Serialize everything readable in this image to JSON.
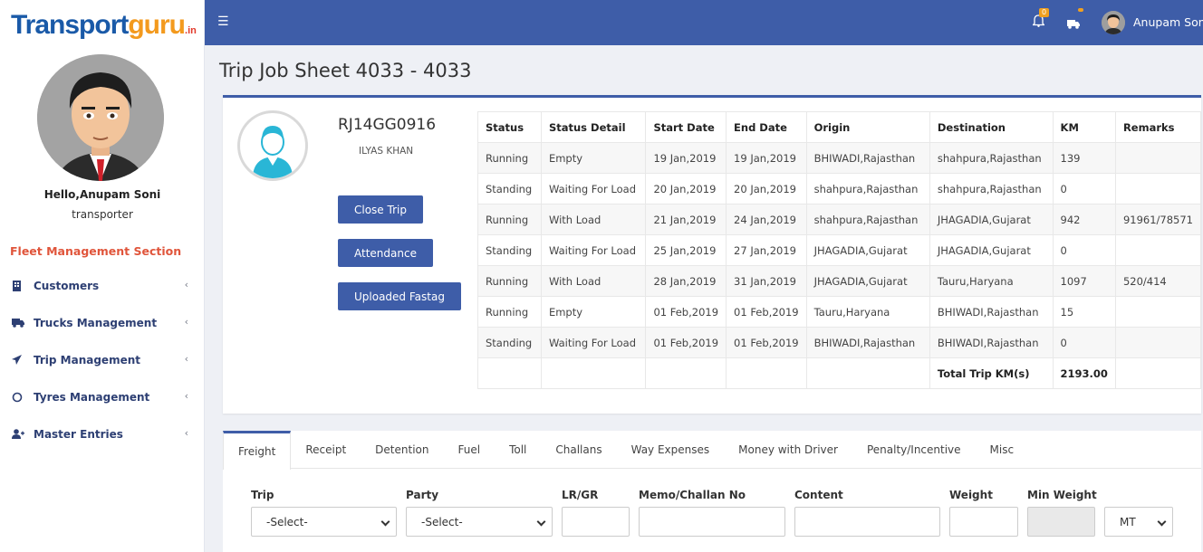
{
  "brand": {
    "logo_main": "Transport",
    "logo_accent": "guru",
    "logo_suffix": ".in"
  },
  "sidebar": {
    "greeting": "Hello,Anupam Soni",
    "role": "transporter",
    "section_title": "Fleet Management Section",
    "items": [
      {
        "label": "Customers",
        "icon": "building-icon"
      },
      {
        "label": "Trucks Management",
        "icon": "truck-icon"
      },
      {
        "label": "Trip Management",
        "icon": "paper-plane-icon"
      },
      {
        "label": "Tyres Management",
        "icon": "circle-icon"
      },
      {
        "label": "Master Entries",
        "icon": "user-plus-icon"
      }
    ]
  },
  "topbar": {
    "notification_count": "0",
    "user_name": "Anupam Soni"
  },
  "page": {
    "title": "Trip Job Sheet 4033 - 4033"
  },
  "vehicle": {
    "number": "RJ14GG0916",
    "driver": "ILYAS KHAN"
  },
  "actions": {
    "close_trip": "Close Trip",
    "attendance": "Attendance",
    "fastag": "Uploaded Fastag"
  },
  "trips": {
    "headers": [
      "Status",
      "Status Detail",
      "Start Date",
      "End Date",
      "Origin",
      "Destination",
      "KM",
      "Remarks"
    ],
    "rows": [
      [
        "Running",
        "Empty",
        "19 Jan,2019",
        "19 Jan,2019",
        "BHIWADI,Rajasthan",
        "shahpura,Rajasthan",
        "139",
        ""
      ],
      [
        "Standing",
        "Waiting For Load",
        "20 Jan,2019",
        "20 Jan,2019",
        "shahpura,Rajasthan",
        "shahpura,Rajasthan",
        "0",
        ""
      ],
      [
        "Running",
        "With Load",
        "21 Jan,2019",
        "24 Jan,2019",
        "shahpura,Rajasthan",
        "JHAGADIA,Gujarat",
        "942",
        "91961/78571"
      ],
      [
        "Standing",
        "Waiting For Load",
        "25 Jan,2019",
        "27 Jan,2019",
        "JHAGADIA,Gujarat",
        "JHAGADIA,Gujarat",
        "0",
        ""
      ],
      [
        "Running",
        "With Load",
        "28 Jan,2019",
        "31 Jan,2019",
        "JHAGADIA,Gujarat",
        "Tauru,Haryana",
        "1097",
        "520/414"
      ],
      [
        "Running",
        "Empty",
        "01 Feb,2019",
        "01 Feb,2019",
        "Tauru,Haryana",
        "BHIWADI,Rajasthan",
        "15",
        ""
      ],
      [
        "Standing",
        "Waiting For Load",
        "01 Feb,2019",
        "01 Feb,2019",
        "BHIWADI,Rajasthan",
        "BHIWADI,Rajasthan",
        "0",
        ""
      ]
    ],
    "total_label": "Total Trip KM(s)",
    "total_value": "2193.00"
  },
  "tabs": [
    "Freight",
    "Receipt",
    "Detention",
    "Fuel",
    "Toll",
    "Challans",
    "Way Expenses",
    "Money with Driver",
    "Penalty/Incentive",
    "Misc"
  ],
  "form": {
    "trip_label": "Trip",
    "trip_value": "-Select-",
    "party_label": "Party",
    "party_value": "-Select-",
    "lr_label": "LR/GR",
    "memo_label": "Memo/Challan No",
    "content_label": "Content",
    "weight_label": "Weight",
    "min_weight_label": "Min Weight",
    "unit_value": "MT"
  }
}
